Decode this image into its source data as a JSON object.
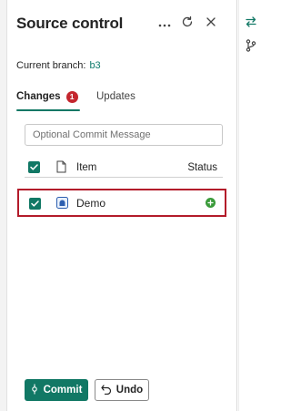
{
  "panel": {
    "title": "Source control",
    "more_icon": "more-horizontal-icon",
    "refresh_icon": "refresh-icon",
    "close_icon": "close-icon"
  },
  "branch": {
    "label": "Current branch:",
    "name": "b3"
  },
  "tabs": [
    {
      "label": "Changes",
      "badge": "1",
      "active": true
    },
    {
      "label": "Updates",
      "active": false
    }
  ],
  "commit_message": {
    "placeholder": "Optional Commit Message",
    "value": ""
  },
  "list": {
    "columns": [
      "Item",
      "Status"
    ],
    "rows": [
      {
        "name": "Demo",
        "checked": true,
        "status": "added",
        "status_icon": "add-circle-icon"
      }
    ]
  },
  "actions": {
    "commit_label": "Commit",
    "undo_label": "Undo"
  },
  "rail": {
    "items": [
      "source-control-icon",
      "branch-icon"
    ]
  },
  "colors": {
    "accent": "#117865",
    "badge": "#c4262e",
    "highlight_border": "#b31b2a",
    "status_added": "#3b9b3b"
  }
}
